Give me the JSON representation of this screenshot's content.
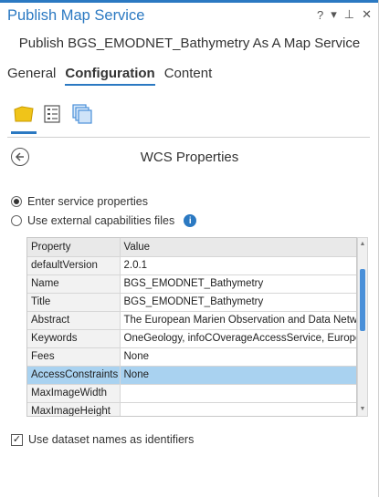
{
  "pane": {
    "title": "Publish Map Service",
    "help": "?",
    "menu": "▾",
    "pin": "⊥",
    "close": "✕"
  },
  "subtitle": "Publish BGS_EMODNET_Bathymetry As A Map Service",
  "tabs": [
    {
      "label": "General",
      "active": false
    },
    {
      "label": "Configuration",
      "active": true
    },
    {
      "label": "Content",
      "active": false
    }
  ],
  "config_icons": [
    "layer-folder-icon",
    "properties-list-icon",
    "capabilities-stack-icon"
  ],
  "section": {
    "title": "WCS Properties"
  },
  "options": {
    "enter_props": "Enter service properties",
    "external_caps": "Use external capabilities files"
  },
  "grid": {
    "headers": [
      "Property",
      "Value"
    ],
    "rows": [
      {
        "property": "defaultVersion",
        "value": "2.0.1"
      },
      {
        "property": "Name",
        "value": "BGS_EMODNET_Bathymetry"
      },
      {
        "property": "Title",
        "value": "BGS_EMODNET_Bathymetry"
      },
      {
        "property": "Abstract",
        "value": "The European Marien Observation and Data Networ"
      },
      {
        "property": "Keywords",
        "value": "OneGeology, infoCOverageAccessService, Europe, El"
      },
      {
        "property": "Fees",
        "value": "None"
      },
      {
        "property": "AccessConstraints",
        "value": "None"
      },
      {
        "property": "MaxImageWidth",
        "value": ""
      },
      {
        "property": "MaxImageHeight",
        "value": ""
      }
    ],
    "selected_row": 6
  },
  "dataset_names": {
    "label": "Use dataset names as identifiers",
    "checked": true
  },
  "colors": {
    "accent": "#2b79c2",
    "selection": "#a9d2f0",
    "folder": "#f0c419"
  }
}
